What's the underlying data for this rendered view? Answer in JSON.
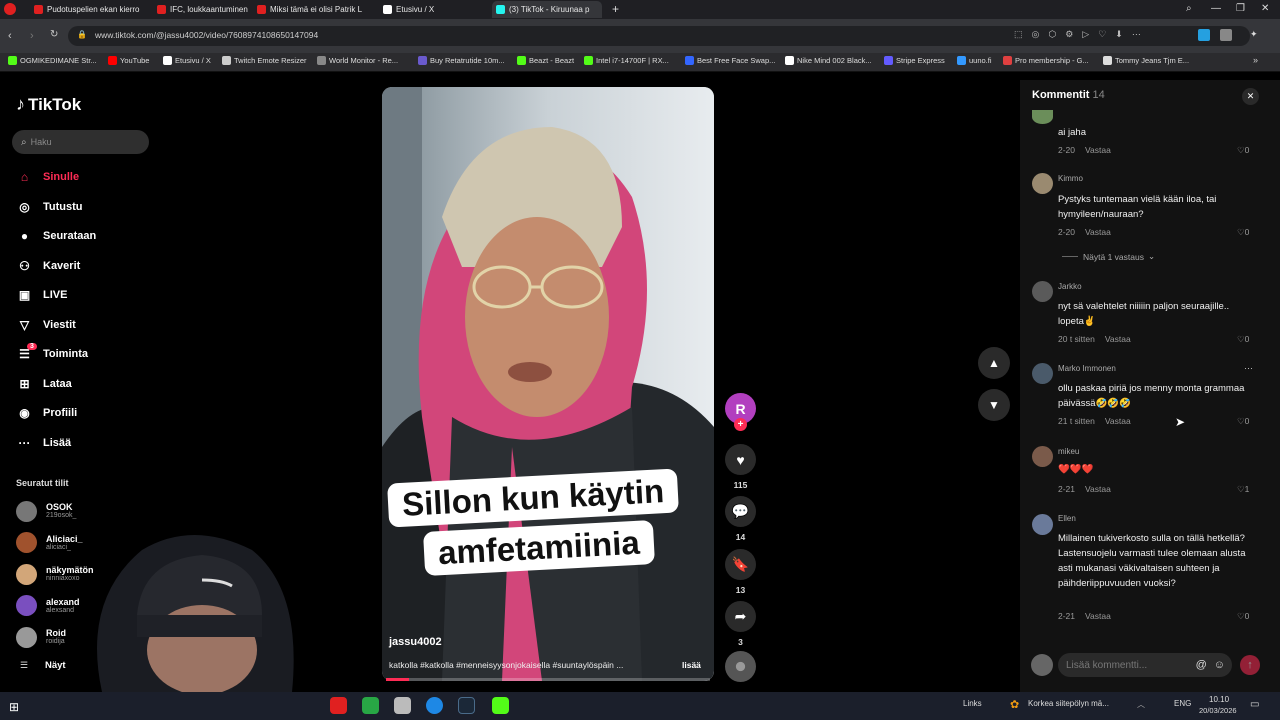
{
  "browser": {
    "tabs": [
      {
        "title": "Pudotuspelien ekan kierro",
        "color": "#e02020"
      },
      {
        "title": "IFC, loukkaantuminen & V",
        "color": "#e02020"
      },
      {
        "title": "Miksi tämä ei olisi Patrik L",
        "color": "#e02020"
      },
      {
        "title": "Etusivu / X",
        "color": "#ffffff"
      },
      {
        "title": "(3) TikTok - Kiruunaa p",
        "color": "#25f4ee"
      }
    ],
    "new_tab": "+",
    "url": "www.tiktok.com/@jassu4002/video/7608974108650147094",
    "bookmarks": [
      {
        "label": "OGMIKEDIMANE Str...",
        "color": "#53fc18"
      },
      {
        "label": "YouTube",
        "color": "#ff0000"
      },
      {
        "label": "Etusivu / X",
        "color": "#ffffff"
      },
      {
        "label": "Twitch Emote Resizer",
        "color": "#cccccc"
      },
      {
        "label": "World Monitor - Re...",
        "color": "#888888"
      },
      {
        "label": "Buy Retatrutide 10m...",
        "color": "#6a5acd"
      },
      {
        "label": "Beazt - Beazt",
        "color": "#53fc18"
      },
      {
        "label": "Intel i7-14700F | RX...",
        "color": "#53fc18"
      },
      {
        "label": "Best Free Face Swap...",
        "color": "#3366ff"
      },
      {
        "label": "Nike Mind 002 Black...",
        "color": "#ffffff"
      },
      {
        "label": "Stripe Express",
        "color": "#635bff"
      },
      {
        "label": "uuno.fi",
        "color": "#3399ff"
      },
      {
        "label": "Pro membership - G...",
        "color": "#e04040"
      },
      {
        "label": "Tommy Jeans Tjm E...",
        "color": "#dddddd"
      }
    ]
  },
  "sidebar": {
    "logo": "TikTok",
    "search_placeholder": "Haku",
    "nav": [
      {
        "label": "Sinulle",
        "icon": "home-icon",
        "active": true
      },
      {
        "label": "Tutustu",
        "icon": "compass-icon"
      },
      {
        "label": "Seurataan",
        "icon": "following-icon"
      },
      {
        "label": "Kaverit",
        "icon": "friends-icon"
      },
      {
        "label": "LIVE",
        "icon": "live-icon"
      },
      {
        "label": "Viestit",
        "icon": "messages-icon"
      },
      {
        "label": "Toiminta",
        "icon": "activity-icon",
        "badge": "3"
      },
      {
        "label": "Lataa",
        "icon": "upload-icon"
      },
      {
        "label": "Profiili",
        "icon": "profile-icon"
      },
      {
        "label": "Lisää",
        "icon": "more-icon"
      }
    ],
    "following_title": "Seuratut tilit",
    "following": [
      {
        "name": "OSOK",
        "handle": "219osok_",
        "color": "#777"
      },
      {
        "name": "Aliciaci_",
        "handle": "aliciaci_",
        "color": "#a0522d"
      },
      {
        "name": "näkymätön",
        "handle": "ninniaxoxo",
        "color": "#d2a679"
      },
      {
        "name": "alexand",
        "handle": "alexsand",
        "color": "#7a4fbf"
      },
      {
        "name": "Roid",
        "handle": "roidija",
        "color": "#999"
      }
    ],
    "more_label": "Näyt"
  },
  "video": {
    "caption_line1": "Sillon kun käytin",
    "caption_line2": "amfetamiinia",
    "username": "jassu4002",
    "description": "katkolla #katkolla #menneisyysonjokaisella #suuntaylöspäin ...",
    "more": "lisää",
    "progress": 0.07
  },
  "actions": {
    "author_initial": "R",
    "likes": "115",
    "comments": "14",
    "saves": "13",
    "shares": "3"
  },
  "comments": {
    "title": "Kommentit",
    "count": "14",
    "items": [
      {
        "name": "",
        "text": "ai jaha",
        "time": "2-20",
        "reply": "Vastaa",
        "likes": "0",
        "color": "#6b8e5a"
      },
      {
        "name": "Kimmo",
        "text": "Pystyks tuntemaan vielä kään iloa, tai hymyileen/nauraan?",
        "time": "2-20",
        "reply": "Vastaa",
        "likes": "0",
        "color": "#9a8a70"
      },
      {
        "name": "Jarkko",
        "text": "nyt sä valehtelet niiiiin paljon seuraajille.. lopeta✌",
        "time": "20 t sitten",
        "reply": "Vastaa",
        "likes": "0",
        "color": "#5a5a5a"
      },
      {
        "name": "Marko Immonen",
        "text": "ollu paskaa piriä jos menny monta grammaa päivässä🤣🤣🤣",
        "time": "21 t sitten",
        "reply": "Vastaa",
        "likes": "0",
        "color": "#4a5a6a"
      },
      {
        "name": "mikeu",
        "text": "❤️❤️❤️",
        "time": "2-21",
        "reply": "Vastaa",
        "likes": "1",
        "color": "#7a5a4a"
      },
      {
        "name": "Ellen",
        "text": "Millainen tukiverkosto sulla on tällä hetkellä? Lastensuojelu varmasti tulee olemaan alusta asti mukanasi väkivaltaisen suhteen ja päihderiippuvuuden vuoksi?",
        "time": "2-21",
        "reply": "Vastaa",
        "likes": "0",
        "color": "#6a7a9a"
      }
    ],
    "show_replies": "Näytä 1 vastaus",
    "input_placeholder": "Lisää kommentti...",
    "comment_more": "···"
  },
  "taskbar": {
    "links": "Links",
    "weather": "Korkea siitepölyn mä...",
    "lang": "ENG",
    "time": "10.10",
    "date": "20/03/2026"
  }
}
